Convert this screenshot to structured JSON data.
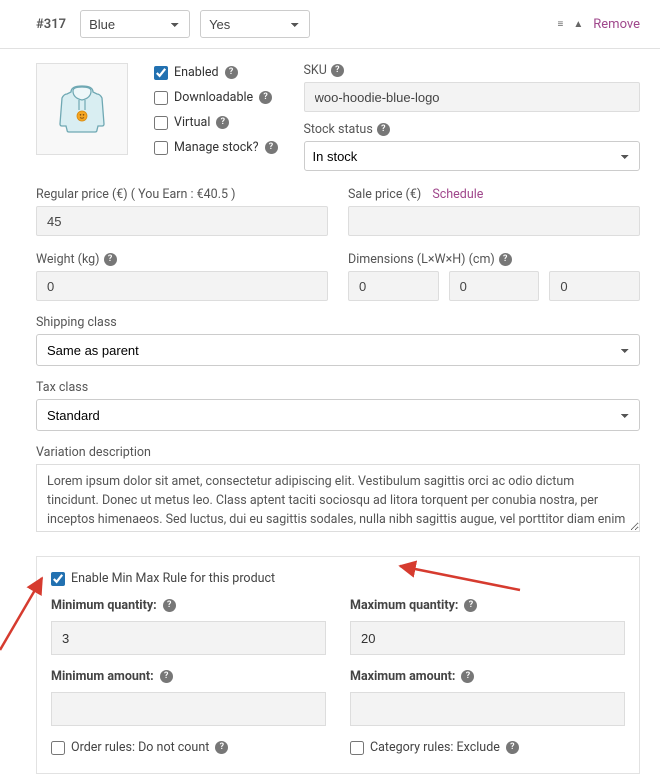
{
  "header": {
    "variation_id": "#317",
    "attr1_selected": "Blue",
    "attr2_selected": "Yes",
    "remove_label": "Remove"
  },
  "checkboxes": {
    "enabled_label": "Enabled",
    "enabled": true,
    "downloadable_label": "Downloadable",
    "downloadable": false,
    "virtual_label": "Virtual",
    "virtual": false,
    "manage_stock_label": "Manage stock?",
    "manage_stock": false
  },
  "sku": {
    "label": "SKU",
    "value": "woo-hoodie-blue-logo"
  },
  "stock": {
    "label": "Stock status",
    "value": "In stock"
  },
  "price": {
    "regular_label": "Regular price (€) ( You Earn : €40.5 )",
    "regular_value": "45",
    "sale_label": "Sale price (€)",
    "schedule_link": "Schedule",
    "sale_value": ""
  },
  "weight": {
    "label": "Weight (kg)",
    "value": "0"
  },
  "dimensions": {
    "label": "Dimensions (L×W×H) (cm)",
    "l": "0",
    "w": "0",
    "h": "0"
  },
  "shipping_class": {
    "label": "Shipping class",
    "value": "Same as parent"
  },
  "tax_class": {
    "label": "Tax class",
    "value": "Standard"
  },
  "description": {
    "label": "Variation description",
    "value": "Lorem ipsum dolor sit amet, consectetur adipiscing elit. Vestibulum sagittis orci ac odio dictum tincidunt. Donec ut metus leo. Class aptent taciti sociosqu ad litora torquent per conubia nostra, per inceptos himenaeos. Sed luctus, dui eu sagittis sodales, nulla nibh sagittis augue, vel porttitor diam enim non metus. Vestibulum aliquam augue neque. Phasellus tincidunt odio eget ullamcorper efficitur. Cras placerat ut"
  },
  "minmax": {
    "enable_label": "Enable Min Max Rule for this product",
    "enable": true,
    "min_qty_label": "Minimum quantity:",
    "min_qty": "3",
    "max_qty_label": "Maximum quantity:",
    "max_qty": "20",
    "min_amt_label": "Minimum amount:",
    "min_amt": "",
    "max_amt_label": "Maximum amount:",
    "max_amt": "",
    "order_rules_label": "Order rules: Do not count",
    "category_rules_label": "Category rules: Exclude"
  }
}
